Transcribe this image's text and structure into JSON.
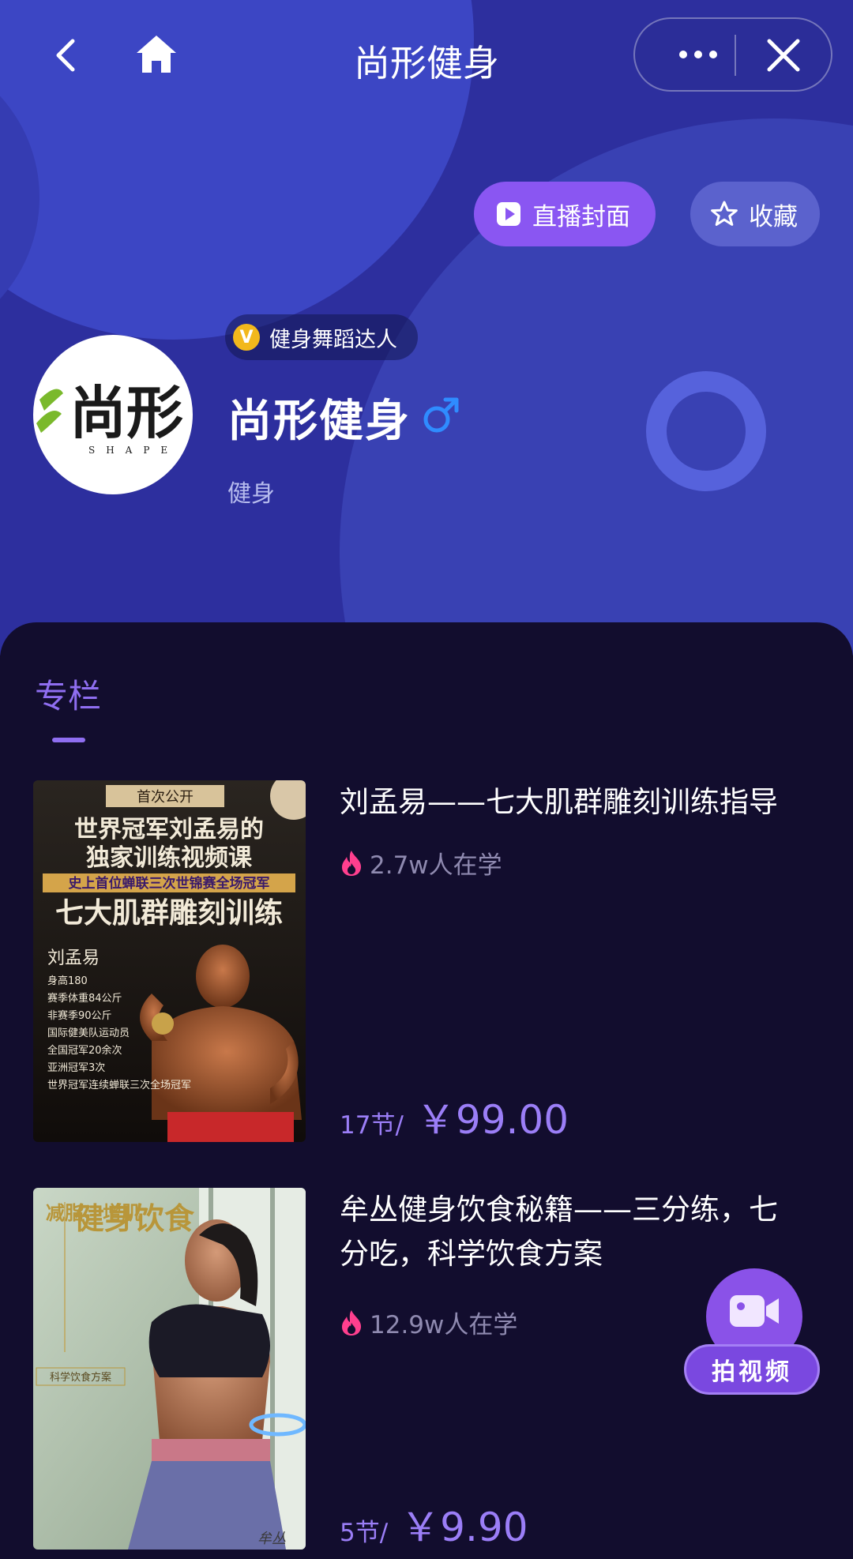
{
  "nav": {
    "title": "尚形健身"
  },
  "header": {
    "live_cover_label": "直播封面",
    "favorite_label": "收藏"
  },
  "profile": {
    "badge": "健身舞蹈达人",
    "badge_mark": "V",
    "name": "尚形健身",
    "category": "健身",
    "avatar_logo_text": "尚形",
    "avatar_logo_subtext": "SHAPE"
  },
  "tabs": [
    {
      "label": "专栏",
      "active": true
    }
  ],
  "courses": [
    {
      "title": "刘孟易——七大肌群雕刻训练指导",
      "learners": "2.7w人在学",
      "lessons": "17节/",
      "price": "￥99.00",
      "cover": {
        "top_tag": "首次公开",
        "headline_1": "世界冠军刘孟易的",
        "headline_2": "独家训练视频课",
        "highlight": "史上首位蝉联三次世锦赛全场冠军",
        "headline_3": "七大肌群雕刻训练",
        "person": "刘孟易",
        "facts": [
          "身高180",
          "赛季体重84公斤",
          "非赛季90公斤",
          "国际健美队运动员",
          "全国冠军20余次",
          "亚洲冠军3次",
          "世界冠军连续蝉联三次全场冠军"
        ]
      }
    },
    {
      "title": "牟丛健身饮食秘籍——三分练，七分吃，科学饮食方案",
      "learners": "12.9w人在学",
      "lessons": "5节/",
      "price": "￥9.90",
      "cover": {
        "side_text": "减脂、增肌",
        "main_text": "健身饮食",
        "sub_text": "科学饮食方案",
        "signature": "牟丛"
      }
    }
  ],
  "fab": {
    "label": "拍视频"
  },
  "colors": {
    "header_bg": "#2d2f9e",
    "content_bg": "#120d2e",
    "accent_purple": "#8f6ef1",
    "live_pill": "#8a56f2",
    "gender_blue": "#2f8cff",
    "fire": "#ff3f8e"
  },
  "icons": [
    "back-arrow-icon",
    "home-icon",
    "more-icon",
    "close-icon",
    "play-icon",
    "star-icon",
    "male-icon",
    "fire-icon",
    "video-camera-icon"
  ]
}
